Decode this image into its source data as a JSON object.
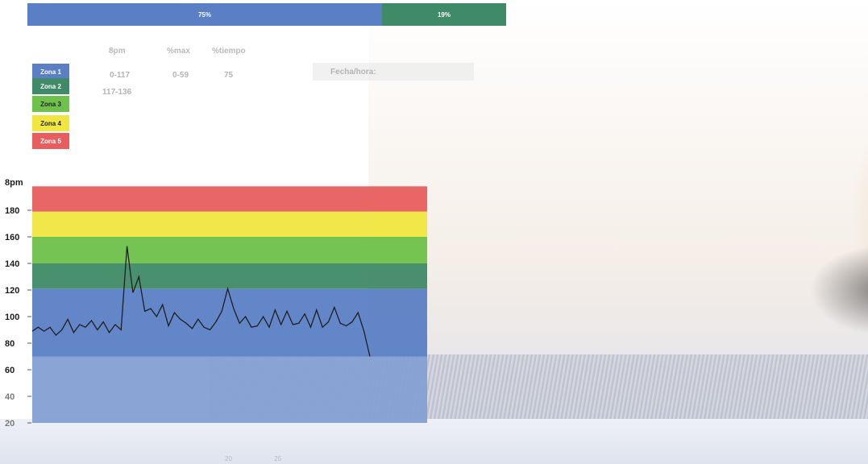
{
  "top_bar": {
    "segments": [
      {
        "label": "75%",
        "value": 75,
        "color": "#5a7fc4"
      },
      {
        "label": "19%",
        "value": 19,
        "color": "#3f8a67"
      }
    ]
  },
  "table": {
    "headers": [
      "8pm",
      "%max",
      "%tiempo"
    ],
    "rows": [
      [
        "0-117",
        "0-59",
        "75"
      ],
      [
        "117-136",
        "",
        ""
      ]
    ]
  },
  "zones": [
    {
      "label": "Zona 1",
      "color": "#5a7fc4",
      "text_color": "#ffffff",
      "range": [
        20,
        121
      ]
    },
    {
      "label": "Zona 2",
      "color": "#3f8a67",
      "text_color": "#ffffff",
      "range": [
        121,
        140
      ]
    },
    {
      "label": "Zona 3",
      "color": "#6ec14a",
      "text_color": "#222222",
      "range": [
        140,
        160
      ]
    },
    {
      "label": "Zona 4",
      "color": "#f1e640",
      "text_color": "#222222",
      "range": [
        160,
        179
      ]
    },
    {
      "label": "Zona 5",
      "color": "#e85e5e",
      "text_color": "#ffffff",
      "range": [
        179,
        198
      ]
    }
  ],
  "fecha_label": "Fecha/hora:",
  "chart_data": {
    "type": "line",
    "ylabel": "8pm",
    "ylim": [
      20,
      200
    ],
    "yticks": [
      20,
      40,
      60,
      80,
      100,
      120,
      140,
      160,
      180
    ],
    "xlim": [
      0,
      40
    ],
    "xticks": [
      20,
      25
    ],
    "bands": [
      {
        "name": "Zona 1",
        "from": 20,
        "to": 121,
        "color": "#5a7fc4"
      },
      {
        "name": "Zona 2",
        "from": 121,
        "to": 140,
        "color": "#3f8a67"
      },
      {
        "name": "Zona 3",
        "from": 140,
        "to": 160,
        "color": "#6ec14a"
      },
      {
        "name": "Zona 4",
        "from": 160,
        "to": 179,
        "color": "#f1e640"
      },
      {
        "name": "Zona 5",
        "from": 179,
        "to": 198,
        "color": "#e85e5e"
      }
    ],
    "series": [
      {
        "values_x": [
          0,
          0.6,
          1.2,
          1.8,
          2.4,
          3.0,
          3.6,
          4.2,
          4.8,
          5.4,
          6.0,
          6.6,
          7.2,
          7.8,
          8.4,
          9.0,
          9.6,
          10.2,
          10.8,
          11.4,
          12.0,
          12.6,
          13.2,
          13.8,
          14.4,
          15.0,
          15.6,
          16.2,
          16.8,
          17.4,
          18.0,
          18.6,
          19.2,
          19.8,
          20.4,
          21.0,
          21.6,
          22.2,
          22.8,
          23.4,
          24.0,
          24.6,
          25.2,
          25.8,
          26.4,
          27.0,
          27.6,
          28.2,
          28.8,
          29.4,
          30.0,
          30.6,
          31.2,
          31.8,
          32.4,
          33.0,
          33.6,
          34.2
        ],
        "values_y": [
          89,
          92,
          89,
          92,
          86,
          90,
          98,
          88,
          94,
          92,
          97,
          90,
          96,
          88,
          94,
          90,
          153,
          118,
          130,
          104,
          106,
          100,
          109,
          93,
          103,
          98,
          95,
          91,
          98,
          92,
          90,
          96,
          104,
          121,
          106,
          95,
          100,
          92,
          93,
          100,
          92,
          105,
          94,
          104,
          94,
          95,
          102,
          92,
          105,
          92,
          96,
          107,
          95,
          93,
          96,
          103,
          89,
          70
        ]
      }
    ]
  }
}
